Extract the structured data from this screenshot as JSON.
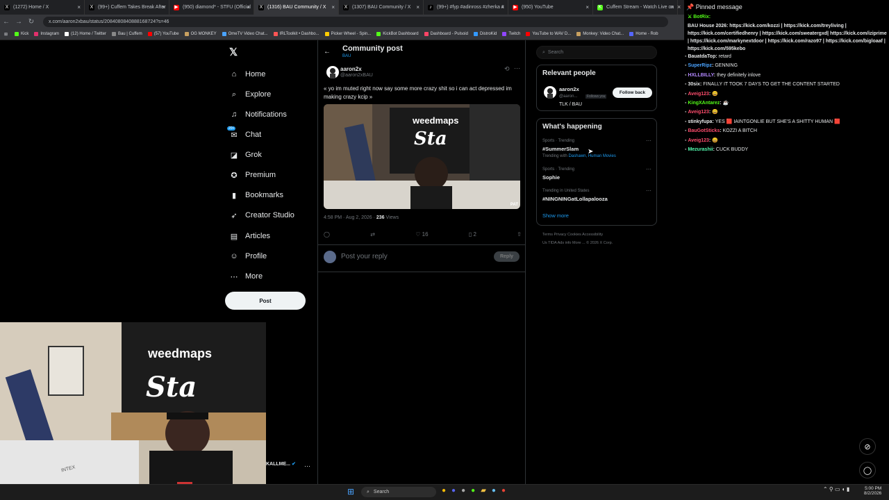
{
  "browser": {
    "tabs": [
      {
        "label": "(1272) Home / X",
        "color": "#000000",
        "glyph": "X"
      },
      {
        "label": "(99+) Cuffem Takes Break After",
        "color": "#000000",
        "glyph": "X"
      },
      {
        "label": "(950) diamond* - STFU (Official",
        "color": "#ff0000",
        "glyph": "▶"
      },
      {
        "label": "(1316) BAU Community / X",
        "color": "#000000",
        "glyph": "X"
      },
      {
        "label": "(1307) BAU Community / X",
        "color": "#000000",
        "glyph": "X"
      },
      {
        "label": "(99+) #fyp #adinross #zherka #",
        "color": "#000000",
        "glyph": "♪"
      },
      {
        "label": "(950) YouTube",
        "color": "#ff0000",
        "glyph": "▶"
      },
      {
        "label": "Cuffem Stream - Watch Live on",
        "color": "#53fc18",
        "glyph": "K"
      }
    ],
    "url": "x.com/aaron2xbau/status/2084080840888168724?s=46",
    "bookmarks": [
      {
        "label": "Kick",
        "color": "#53fc18"
      },
      {
        "label": "Instagram",
        "color": "#e1306c"
      },
      {
        "label": "(12) Home / Twitter",
        "color": "#ffffff"
      },
      {
        "label": "Bau | Cuffem",
        "color": "#888888"
      },
      {
        "label": "(57) YouTube",
        "color": "#ff0000"
      },
      {
        "label": "OG MONKEY",
        "color": "#c8a060"
      },
      {
        "label": "OmeTV Video Chat...",
        "color": "#4aa3ff"
      },
      {
        "label": "IRLToolkit • Dashbo...",
        "color": "#ff5555"
      },
      {
        "label": "Picker Wheel - Spin...",
        "color": "#ffcc00"
      },
      {
        "label": "KickBot Dashboard",
        "color": "#53fc18"
      },
      {
        "label": "Dashboard - Pulsoid",
        "color": "#ff4466"
      },
      {
        "label": "DistroKid",
        "color": "#3399ff"
      },
      {
        "label": "Twitch",
        "color": "#9146ff"
      },
      {
        "label": "YouTube to WAV D...",
        "color": "#ff0000"
      },
      {
        "label": "Monkey: Video Chat...",
        "color": "#c8a060"
      },
      {
        "label": "Home - Rob",
        "color": "#5566ff"
      }
    ]
  },
  "sidebar": {
    "items": [
      {
        "label": "Home",
        "icon": "⌂"
      },
      {
        "label": "Explore",
        "icon": "⌕"
      },
      {
        "label": "Notifications",
        "icon": "♫"
      },
      {
        "label": "Chat",
        "icon": "✉"
      },
      {
        "label": "Grok",
        "icon": "◪"
      },
      {
        "label": "Premium",
        "icon": "✪"
      },
      {
        "label": "Bookmarks",
        "icon": "▮"
      },
      {
        "label": "Creator Studio",
        "icon": "➶"
      },
      {
        "label": "Articles",
        "icon": "▤"
      },
      {
        "label": "Profile",
        "icon": "☺"
      },
      {
        "label": "More",
        "icon": "⋯"
      }
    ],
    "chat_badge": "20+",
    "post_button": "Post"
  },
  "post": {
    "header_title": "Community post",
    "header_sub": "BAU",
    "author_name": "aaron2x",
    "author_handle": "@aaron2xBAU",
    "text": "« yo im muted right now say some more crazy shit so i can act depressed im making crazy kcip »",
    "time": "4:58 PM · Aug 2, 2026 ·",
    "views_count": "236",
    "views_label": "Views",
    "likes": "16",
    "bookmarks": "2",
    "media_text": "weedmaps",
    "media_text2": "Sta",
    "media_badge": "PAT"
  },
  "reply": {
    "placeholder": "Post your reply",
    "button": "Reply"
  },
  "right": {
    "search_placeholder": "Search",
    "relevant_title": "Relevant people",
    "person_name": "aaron2x",
    "person_handle": "@aaron...",
    "follows_you": "Follows you",
    "person_bio": "TLK / BAU",
    "follow_button": "Follow back",
    "happening_title": "What's happening",
    "trends": [
      {
        "context": "Sports · Trending",
        "name": "#SummerSlam",
        "extra_prefix": "Trending with",
        "extra_links": "Dashawn, Human Movies"
      },
      {
        "context": "Sports · Trending",
        "name": "Sophie",
        "extra_prefix": "",
        "extra_links": ""
      },
      {
        "context": "Trending in United States",
        "name": "#NINGNINGatLollapalooza",
        "extra_prefix": "",
        "extra_links": ""
      }
    ],
    "show_more": "Show more",
    "footer_line1": "Terms    Privacy    Cookies    Accessibility",
    "footer_line2": "Us TIDA    Ads info    More ...    © 2026 X Corp."
  },
  "chat": {
    "pinned_label": "Pinned message",
    "pinned_author": "BotRix:",
    "pinned_text": "BAU House 2026: https://kick.com/kozzi | https://kick.com/treyliving | https://kick.com/certifiedhenry | https://kick.com/sweatergxd| https://kick.com/iziprime | https://kick.com/markynextdoor | https://kick.com/razo97 | https://kick.com/bigloaaf | https://kick.com/595kebo",
    "messages": [
      {
        "user": "BauatdaTop",
        "color": "#e7e9ea",
        "text": "retard"
      },
      {
        "user": "SuperRipz",
        "color": "#4aa3ff",
        "text": "GENNING"
      },
      {
        "user": "HXLLBILLY",
        "color": "#b388ff",
        "text": "they definitely inlove"
      },
      {
        "user": "30six",
        "color": "#e7e9ea",
        "text": "FINALLY IT TOOK 7 DAYS TO GET THE CONTENT STARTED"
      },
      {
        "user": "Aveig123",
        "color": "#ff4d6d",
        "text": "😄"
      },
      {
        "user": "KingXAntarez",
        "color": "#53fc18",
        "text": "☕"
      },
      {
        "user": "Aveig123",
        "color": "#ff4d6d",
        "text": "😄"
      },
      {
        "user": "stinkyfupa",
        "color": "#e7e9ea",
        "text": "YES 🟥 IAINTGONLIE BUT SHE'S A SHITTY HUMAN 🟥"
      },
      {
        "user": "BauGotSticks",
        "color": "#ff4d6d",
        "text": "KOZZI A BITCH"
      },
      {
        "user": "Aveig123",
        "color": "#ff4d6d",
        "text": "😄"
      },
      {
        "user": "Mezurashii",
        "color": "#53fcb0",
        "text": "CUCK BUDDY"
      }
    ]
  },
  "webcam": {
    "sign_text": "weedmaps",
    "sign_text2": "Sta",
    "mattress_label": "INTEX",
    "overlay_name": "KALLME..."
  },
  "taskbar": {
    "search": "Search",
    "time": "5:00 PM",
    "date": "8/2/2026"
  }
}
